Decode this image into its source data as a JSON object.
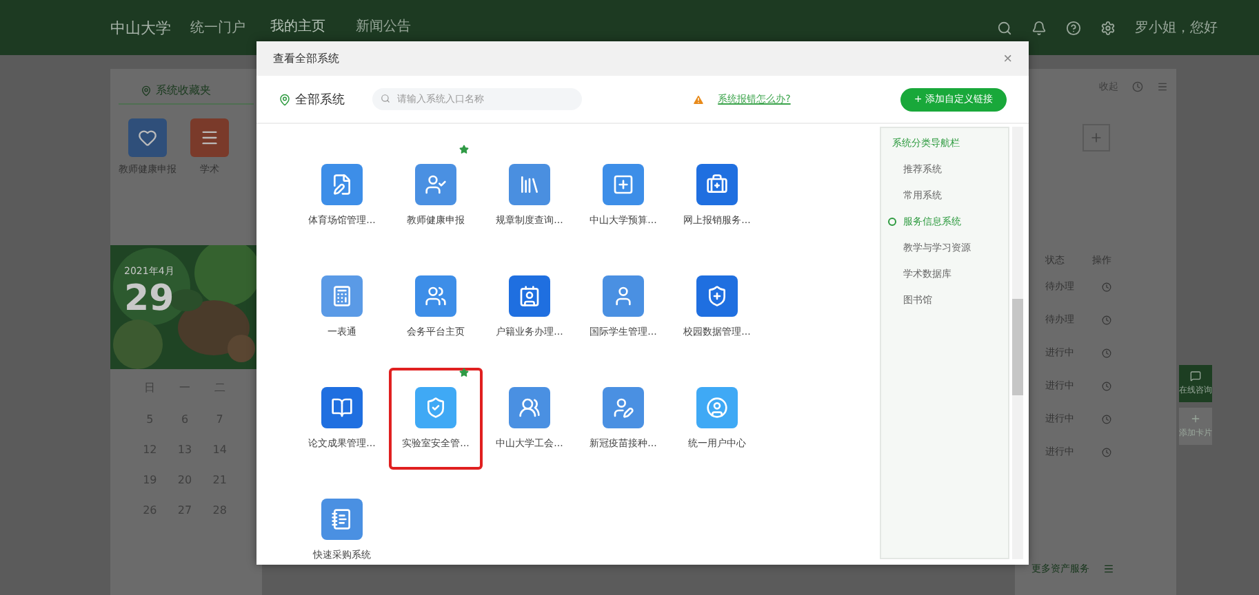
{
  "header": {
    "logo": "中山大学",
    "portal": "统一门户",
    "nav": [
      {
        "label": "我的主页",
        "selected": true
      },
      {
        "label": "新闻公告",
        "selected": false
      }
    ],
    "user": "罗小姐，您好"
  },
  "background": {
    "favorites_tab": "系统收藏夹",
    "favorites": [
      "教师健康申报",
      "学术"
    ],
    "calendar": {
      "month": "2021年4月",
      "day": "29",
      "weekdays": [
        "日",
        "一",
        "二"
      ],
      "weeks": [
        [
          "5",
          "6",
          "7"
        ],
        [
          "12",
          "13",
          "14"
        ],
        [
          "19",
          "20",
          "21"
        ],
        [
          "26",
          "27",
          "28"
        ]
      ]
    },
    "right_links": [
      "收起"
    ],
    "table": {
      "columns": [
        "状态",
        "操作"
      ],
      "rows": [
        "待办理",
        "待办理",
        "进行中",
        "进行中",
        "进行中",
        "进行中"
      ]
    },
    "more": "更多资产服务",
    "side_buttons": [
      "在线咨询",
      "添加卡片"
    ]
  },
  "dialog": {
    "title": "查看全部系统",
    "close": "×",
    "scope": "全部系统",
    "search": {
      "placeholder": "请输入系统入口名称"
    },
    "help_link": "系统报错怎么办?",
    "add_button": "+ 添加自定义链接",
    "systems": [
      {
        "label": "体育场馆管理...",
        "starred": false,
        "highlighted": false,
        "color": "#3d8ee8"
      },
      {
        "label": "教师健康申报",
        "starred": true,
        "highlighted": false,
        "color": "#4a90e2"
      },
      {
        "label": "规章制度查询...",
        "starred": false,
        "highlighted": false,
        "color": "#4a8fe0"
      },
      {
        "label": "中山大学预算...",
        "starred": false,
        "highlighted": false,
        "color": "#3d8ee8"
      },
      {
        "label": "网上报销服务...",
        "starred": false,
        "highlighted": false,
        "color": "#1f6fe0"
      },
      {
        "label": "一表通",
        "starred": false,
        "highlighted": false,
        "color": "#5a9ae6"
      },
      {
        "label": "会务平台主页",
        "starred": false,
        "highlighted": false,
        "color": "#3d8ee8"
      },
      {
        "label": "户籍业务办理...",
        "starred": false,
        "highlighted": false,
        "color": "#1f6fe0"
      },
      {
        "label": "国际学生管理...",
        "starred": false,
        "highlighted": false,
        "color": "#4a90e2"
      },
      {
        "label": "校园数据管理...",
        "starred": false,
        "highlighted": false,
        "color": "#1f6fe0"
      },
      {
        "label": "论文成果管理...",
        "starred": false,
        "highlighted": false,
        "color": "#1f6fe0"
      },
      {
        "label": "实验室安全管...",
        "starred": true,
        "highlighted": true,
        "color": "#3fa9f5"
      },
      {
        "label": "中山大学工会...",
        "starred": false,
        "highlighted": false,
        "color": "#4a90e2"
      },
      {
        "label": "新冠疫苗接种...",
        "starred": false,
        "highlighted": false,
        "color": "#4a90e2"
      },
      {
        "label": "统一用户中心",
        "starred": false,
        "highlighted": false,
        "color": "#3fa9f5"
      },
      {
        "label": "快速采购系统",
        "starred": false,
        "highlighted": false,
        "color": "#4a90e2"
      }
    ],
    "category_nav": {
      "title": "系统分类导航栏",
      "items": [
        {
          "label": "推荐系统",
          "selected": false
        },
        {
          "label": "常用系统",
          "selected": false
        },
        {
          "label": "服务信息系统",
          "selected": true
        },
        {
          "label": "教学与学习资源",
          "selected": false
        },
        {
          "label": "学术数据库",
          "selected": false
        },
        {
          "label": "图书馆",
          "selected": false
        }
      ]
    }
  }
}
